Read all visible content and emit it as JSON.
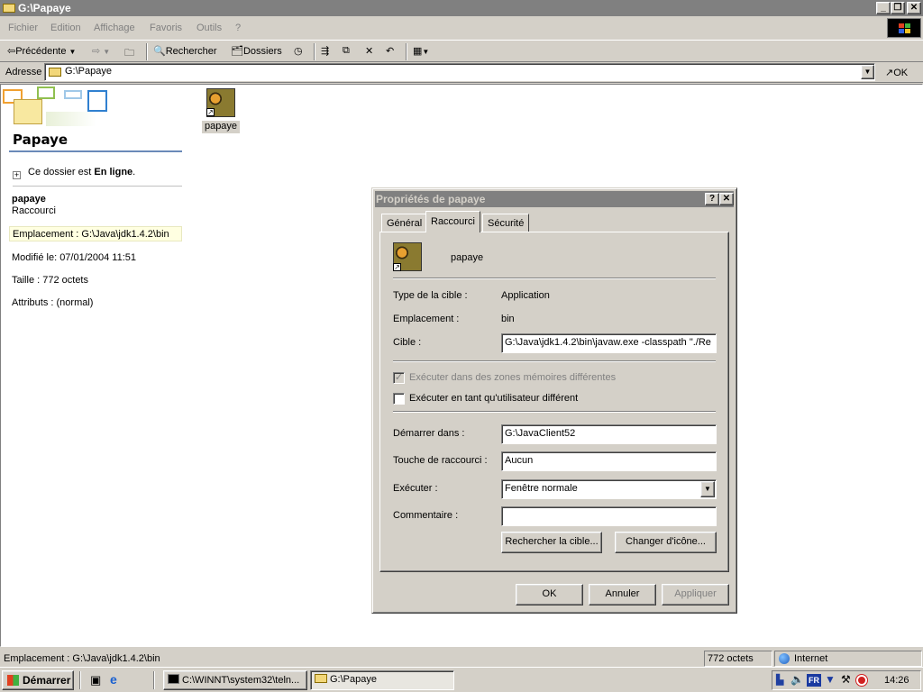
{
  "window": {
    "title": "G:\\Papaye"
  },
  "menu": [
    "Fichier",
    "Edition",
    "Affichage",
    "Favoris",
    "Outils",
    "?"
  ],
  "toolbar": {
    "back": "Précédente",
    "search": "Rechercher",
    "folders": "Dossiers"
  },
  "address": {
    "label": "Adresse",
    "value": "G:\\Papaye",
    "go": "OK"
  },
  "sidepanel": {
    "heading": "Papaye",
    "online_prefix": "Ce dossier est ",
    "online_bold": "En ligne",
    "online_suffix": ".",
    "item_name": "papaye",
    "item_type": "Raccourci",
    "location": "Emplacement : G:\\Java\\jdk1.4.2\\bin",
    "modified": "Modifié le: 07/01/2004 11:51",
    "size": "Taille : 772 octets",
    "attributes": "Attributs : (normal)"
  },
  "file": {
    "label": "papaye"
  },
  "dialog": {
    "title": "Propriétés de papaye",
    "tabs": [
      "Général",
      "Raccourci",
      "Sécurité"
    ],
    "name": "papaye",
    "target_type_label": "Type de la cible :",
    "target_type_value": "Application",
    "location_label": "Emplacement :",
    "location_value": "bin",
    "target_label": "Cible :",
    "target_value": "G:\\Java\\jdk1.4.2\\bin\\javaw.exe -classpath \"./Re",
    "check_memory": "Exécuter dans des zones mémoires différentes",
    "check_user": "Exécuter en tant qu'utilisateur différent",
    "start_in_label": "Démarrer dans :",
    "start_in_value": "G:\\JavaClient52",
    "shortcut_key_label": "Touche de raccourci :",
    "shortcut_key_value": "Aucun",
    "run_label": "Exécuter :",
    "run_value": "Fenêtre normale",
    "comment_label": "Commentaire :",
    "comment_value": "",
    "find_target": "Rechercher la cible...",
    "change_icon": "Changer d'icône...",
    "ok": "OK",
    "cancel": "Annuler",
    "apply": "Appliquer"
  },
  "status": {
    "left": "Emplacement : G:\\Java\\jdk1.4.2\\bin",
    "size": "772 octets",
    "zone": "Internet"
  },
  "taskbar": {
    "start": "Démarrer",
    "task1": "C:\\WINNT\\system32\\teln...",
    "task2": "G:\\Papaye",
    "lang": "FR",
    "clock": "14:26"
  },
  "colors": {
    "titlebar_inactive": "#808080",
    "face": "#d4d0c8",
    "selection_highlight": "#ffffe1"
  }
}
